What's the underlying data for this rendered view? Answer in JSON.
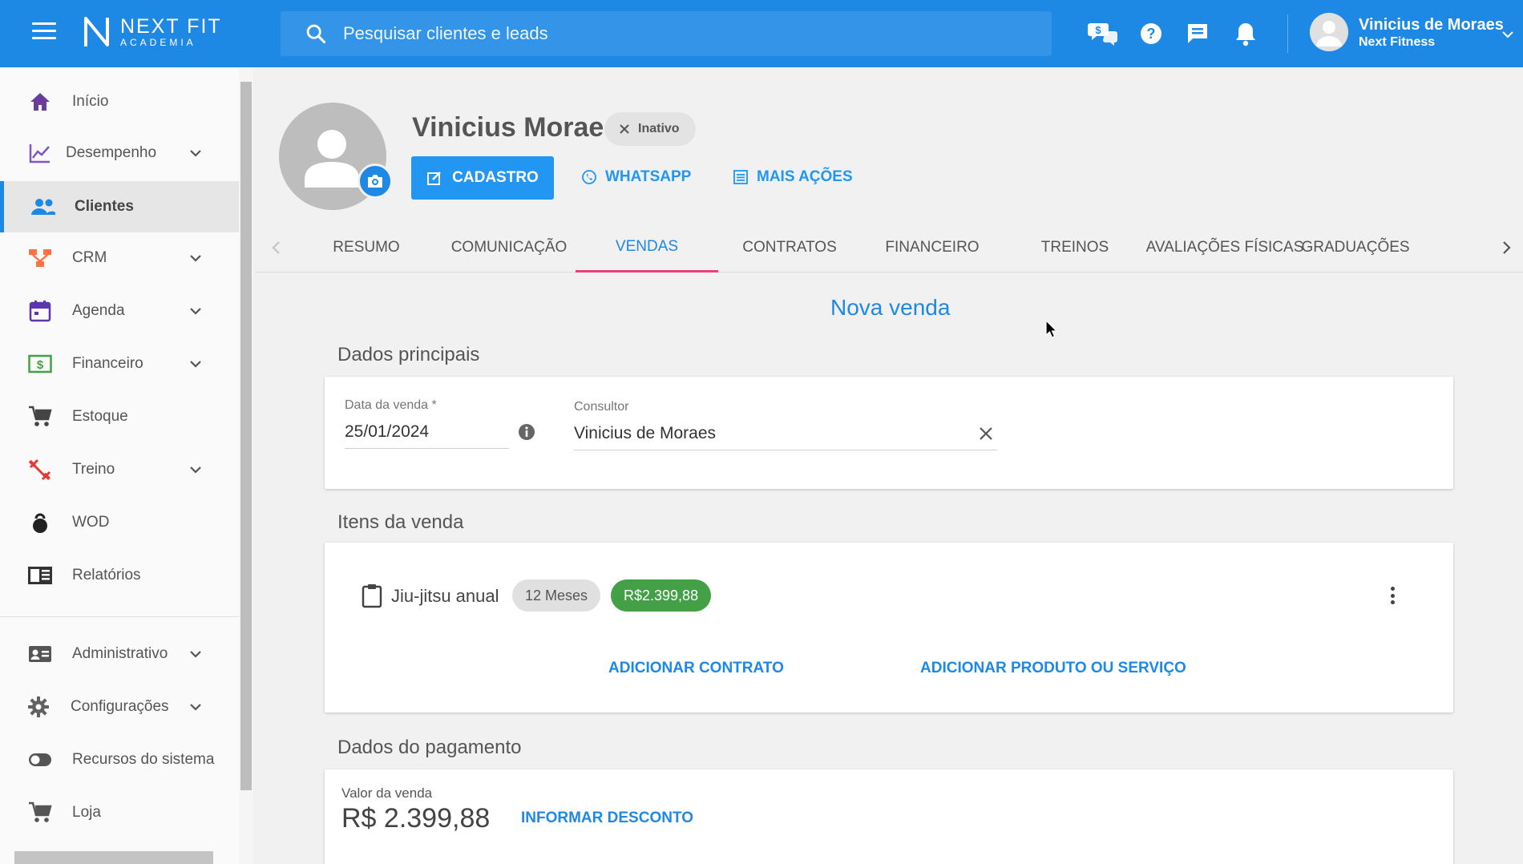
{
  "brand": {
    "name_line1": "NEXT FIT",
    "name_line2": "ACADEMIA"
  },
  "search": {
    "placeholder": "Pesquisar clientes e leads"
  },
  "user": {
    "name": "Vinicius de Moraes",
    "company": "Next Fitness"
  },
  "colors": {
    "primary": "#1e88e5",
    "tab_indicator": "#ec407a",
    "price_chip": "#43a047"
  },
  "sidebar": {
    "items": [
      {
        "label": "Início",
        "icon": "home-icon",
        "color": "#6a3d9a"
      },
      {
        "label": "Desempenho",
        "icon": "chart-line-icon",
        "color": "#7e57c2",
        "expandable": true
      },
      {
        "label": "Clientes",
        "icon": "people-icon",
        "color": "#1e88e5",
        "active": true
      },
      {
        "label": "CRM",
        "icon": "crm-icon",
        "color": "#ff7043",
        "expandable": true
      },
      {
        "label": "Agenda",
        "icon": "calendar-icon",
        "color": "#5e35b1",
        "expandable": true
      },
      {
        "label": "Financeiro",
        "icon": "money-icon",
        "color": "#43a047",
        "expandable": true
      },
      {
        "label": "Estoque",
        "icon": "cart-icon",
        "color": "#444444"
      },
      {
        "label": "Treino",
        "icon": "dumbbell-icon",
        "color": "#e53935",
        "expandable": true
      },
      {
        "label": "WOD",
        "icon": "kettlebell-icon",
        "color": "#222222"
      },
      {
        "label": "Relatórios",
        "icon": "report-icon",
        "color": "#333333"
      },
      {
        "label": "Administrativo",
        "icon": "id-card-icon",
        "color": "#555555",
        "expandable": true
      },
      {
        "label": "Configurações",
        "icon": "gear-icon",
        "color": "#616161",
        "expandable": true
      },
      {
        "label": "Recursos do sistema",
        "icon": "toggle-icon",
        "color": "#555555"
      },
      {
        "label": "Loja",
        "icon": "cart-icon",
        "color": "#555555"
      }
    ]
  },
  "client": {
    "name": "Vinicius Moraes",
    "status": "Inativo",
    "actions": {
      "cadastro": "CADASTRO",
      "whatsapp": "WHATSAPP",
      "mais_acoes": "MAIS AÇÕES"
    }
  },
  "tabs": [
    {
      "label": "RESUMO"
    },
    {
      "label": "COMUNICAÇÃO"
    },
    {
      "label": "VENDAS",
      "active": true
    },
    {
      "label": "CONTRATOS"
    },
    {
      "label": "FINANCEIRO"
    },
    {
      "label": "TREINOS"
    },
    {
      "label": "AVALIAÇÕES FÍSICAS"
    },
    {
      "label": "GRADUAÇÕES"
    }
  ],
  "page": {
    "heading": "Nova venda"
  },
  "dados_principais": {
    "title": "Dados principais",
    "data_venda": {
      "label": "Data da venda *",
      "value": "25/01/2024"
    },
    "consultor": {
      "label": "Consultor",
      "value": "Vinicius de Moraes"
    }
  },
  "itens_venda": {
    "title": "Itens da venda",
    "items": [
      {
        "name": "Jiu-jitsu anual",
        "duration": "12 Meses",
        "price": "R$2.399,88"
      }
    ],
    "add_contract": "ADICIONAR CONTRATO",
    "add_product": "ADICIONAR PRODUTO OU SERVIÇO"
  },
  "pagamento": {
    "title": "Dados do pagamento",
    "valor_label": "Valor da venda",
    "valor": "R$ 2.399,88",
    "desconto": "INFORMAR DESCONTO"
  }
}
